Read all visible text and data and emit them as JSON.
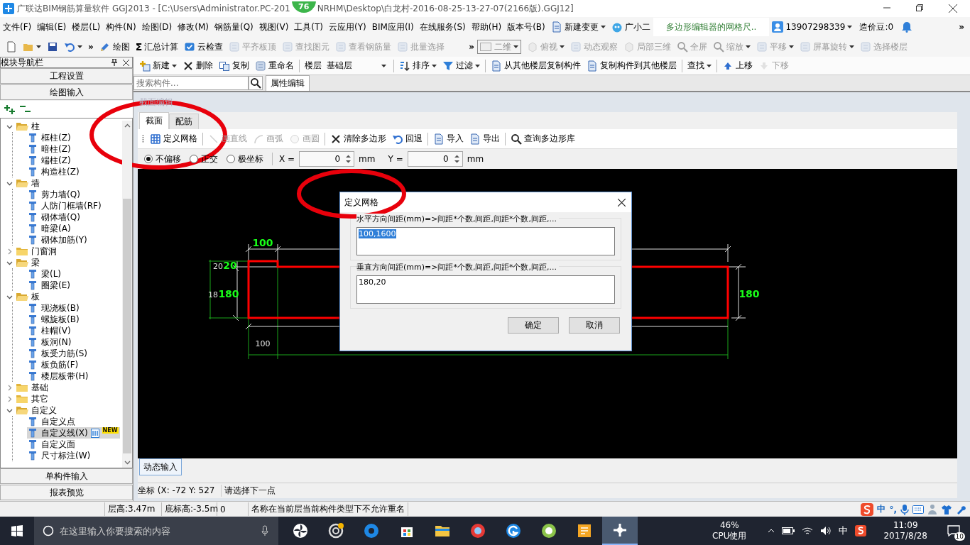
{
  "window": {
    "title_parts": [
      "广联达BIM钢筋算量软件 GGJ2013 - [C:\\Users\\Administrator.PC-201",
      "NRHM\\Desktop\\白龙村-2016-08-25-13-27-07(2166版).GGJ12]"
    ],
    "badge": "76"
  },
  "menu": [
    "文件(F)",
    "编辑(E)",
    "楼层(L)",
    "构件(N)",
    "绘图(D)",
    "修改(M)",
    "钢筋量(Q)",
    "视图(V)",
    "工具(T)",
    "云应用(Y)",
    "BIM应用(I)",
    "在线服务(S)",
    "帮助(H)",
    "版本号(B)"
  ],
  "menu_extras": {
    "new_change": "新建变更",
    "assistant": "广小二",
    "notice": "多边形编辑器的网格尺..",
    "account": "13907298339",
    "beans": "造价豆:0",
    "overflow": "»"
  },
  "main_toolbar": {
    "lead": [
      {
        "kind": "new",
        "dropdown": false
      },
      {
        "kind": "open",
        "dropdown": true
      },
      {
        "kind": "save",
        "dropdown": false
      },
      {
        "kind": "undo",
        "dropdown": true
      }
    ],
    "overflow": "»",
    "items": [
      {
        "label": "绘图",
        "kind": "pencil",
        "disabled": false,
        "dropdown": false
      },
      {
        "label": "汇总计算",
        "glyph": "Σ",
        "disabled": false,
        "dropdown": false
      },
      {
        "label": "云检查",
        "kind": "check",
        "disabled": false,
        "dropdown": false
      },
      {
        "label": "平齐板顶",
        "kind": "tool",
        "disabled": true,
        "dropdown": false
      },
      {
        "label": "查找图元",
        "kind": "tool",
        "disabled": true,
        "dropdown": false
      },
      {
        "label": "查看钢筋量",
        "kind": "tool",
        "disabled": true,
        "dropdown": false
      },
      {
        "label": "批量选择",
        "kind": "tool",
        "disabled": true,
        "dropdown": false
      }
    ],
    "view_mode": "二维",
    "overflow_right": "»",
    "view_items": [
      {
        "label": "俯视",
        "kind": "cube",
        "disabled": true,
        "dropdown": true
      },
      {
        "label": "动态观察",
        "kind": "tool",
        "disabled": true,
        "dropdown": false
      },
      {
        "label": "局部三维",
        "kind": "cube",
        "disabled": true,
        "dropdown": false
      },
      {
        "label": "全屏",
        "kind": "search",
        "disabled": true,
        "dropdown": false
      },
      {
        "label": "缩放",
        "kind": "search",
        "disabled": true,
        "dropdown": true
      },
      {
        "label": "平移",
        "kind": "tool",
        "disabled": true,
        "dropdown": true
      },
      {
        "label": "屏幕旋转",
        "kind": "tool",
        "disabled": true,
        "dropdown": true
      },
      {
        "label": "选择楼层",
        "kind": "tool",
        "disabled": true,
        "dropdown": false
      }
    ]
  },
  "navigator": {
    "title": "模块导航栏",
    "sections_top": [
      "工程设置",
      "绘图输入"
    ],
    "tree": [
      {
        "label": "柱",
        "expanded": true,
        "children": [
          {
            "label": "框柱(Z)",
            "selected": false
          },
          {
            "label": "暗柱(Z)",
            "selected": false
          },
          {
            "label": "端柱(Z)",
            "selected": false
          },
          {
            "label": "构造柱(Z)",
            "selected": false
          }
        ]
      },
      {
        "label": "墙",
        "expanded": true,
        "children": [
          {
            "label": "剪力墙(Q)",
            "selected": false
          },
          {
            "label": "人防门框墙(RF)",
            "selected": false
          },
          {
            "label": "砌体墙(Q)",
            "selected": false
          },
          {
            "label": "暗梁(A)",
            "selected": false
          },
          {
            "label": "砌体加筋(Y)",
            "selected": false
          }
        ]
      },
      {
        "label": "门窗洞",
        "expanded": false
      },
      {
        "label": "梁",
        "expanded": true,
        "children": [
          {
            "label": "梁(L)",
            "selected": false
          },
          {
            "label": "圈梁(E)",
            "selected": false
          }
        ]
      },
      {
        "label": "板",
        "expanded": true,
        "children": [
          {
            "label": "现浇板(B)",
            "selected": false
          },
          {
            "label": "螺旋板(B)",
            "selected": false
          },
          {
            "label": "柱帽(V)",
            "selected": false
          },
          {
            "label": "板洞(N)",
            "selected": false
          },
          {
            "label": "板受力筋(S)",
            "selected": false
          },
          {
            "label": "板负筋(F)",
            "selected": false
          },
          {
            "label": "楼层板带(H)",
            "selected": false
          }
        ]
      },
      {
        "label": "基础",
        "expanded": false
      },
      {
        "label": "其它",
        "expanded": false
      },
      {
        "label": "自定义",
        "expanded": true,
        "children": [
          {
            "label": "自定义点",
            "selected": false
          },
          {
            "label": "自定义线(X)",
            "selected": true,
            "badge": "NEW"
          },
          {
            "label": "自定义面",
            "selected": false
          },
          {
            "label": "尺寸标注(W)",
            "selected": false
          }
        ]
      }
    ],
    "sections_bottom": [
      "单构件输入",
      "报表预览"
    ]
  },
  "component_toolbar": {
    "items": [
      {
        "label": "新建",
        "kind": "plus",
        "disabled": false,
        "dropdown": true
      },
      {
        "label": "删除",
        "kind": "cross",
        "disabled": false,
        "dropdown": false
      },
      {
        "label": "复制",
        "kind": "copy",
        "disabled": false,
        "dropdown": false
      },
      {
        "label": "重命名",
        "kind": "tool",
        "disabled": false,
        "dropdown": false
      }
    ],
    "floor_label": "楼层",
    "floor_value": "基础层",
    "items2": [
      {
        "label": "排序",
        "kind": "sort",
        "disabled": false,
        "dropdown": true
      },
      {
        "label": "过滤",
        "kind": "funnel",
        "disabled": false,
        "dropdown": true
      },
      {
        "label": "从其他楼层复制构件",
        "kind": "doc",
        "disabled": false,
        "dropdown": false
      },
      {
        "label": "复制构件到其他楼层",
        "kind": "doc",
        "disabled": false,
        "dropdown": false
      },
      {
        "label": "查找",
        "disabled": false,
        "dropdown": true
      },
      {
        "label": "上移",
        "kind": "up",
        "disabled": false,
        "dropdown": false
      },
      {
        "label": "下移",
        "kind": "down",
        "disabled": true,
        "dropdown": false
      }
    ]
  },
  "component_search": {
    "placeholder": "搜索构件..."
  },
  "property_tab": "属性编辑",
  "section_editor": {
    "title": "截面编辑",
    "tabs": [
      {
        "label": "截面",
        "selected": true
      },
      {
        "label": "配筋",
        "selected": false
      }
    ],
    "tools": [
      {
        "label": "定义网格",
        "kind": "grid",
        "disabled": false
      },
      {
        "label": "画直线",
        "kind": "line",
        "disabled": true
      },
      {
        "label": "画弧",
        "kind": "arc",
        "disabled": true
      },
      {
        "label": "画圆",
        "kind": "circle",
        "disabled": true
      },
      {
        "label": "清除多边形",
        "kind": "cross",
        "disabled": false
      },
      {
        "label": "回退",
        "kind": "undo",
        "disabled": false
      },
      {
        "label": "导入",
        "kind": "doc",
        "disabled": false
      },
      {
        "label": "导出",
        "kind": "doc",
        "disabled": false
      },
      {
        "label": "查询多边形库",
        "kind": "search",
        "disabled": false
      }
    ],
    "snap_modes": [
      {
        "label": "不偏移",
        "selected": true
      },
      {
        "label": "正交",
        "selected": false
      },
      {
        "label": "极坐标",
        "selected": false
      }
    ],
    "x_label": "X =",
    "x_value": "0",
    "x_unit": "mm",
    "y_label": "Y =",
    "y_value": "0",
    "y_unit": "mm",
    "canvas_labels": [
      {
        "text": "100",
        "kind": "major"
      },
      {
        "text": "20",
        "kind": "minor"
      },
      {
        "text": "20",
        "kind": "major"
      },
      {
        "text": "18",
        "kind": "minor"
      },
      {
        "text": "180",
        "kind": "major"
      },
      {
        "text": "180",
        "kind": "major"
      },
      {
        "text": "100",
        "kind": "minor"
      }
    ],
    "dynamic_input": "动态输入",
    "coord": "坐标 (X: -72 Y: 527",
    "prompt": "请选择下一点"
  },
  "dialog": {
    "title": "定义网格",
    "groups": [
      {
        "label": "水平方向间距(mm)=>间距*个数,间距,间距*个数,间距,...",
        "value": "100,1600",
        "text_selected": true
      },
      {
        "label": "垂直方向间距(mm)=>间距*个数,间距,间距*个数,间距,...",
        "value": "180,20",
        "text_selected": false
      }
    ],
    "buttons": [
      "确定",
      "取消"
    ]
  },
  "status_bar": {
    "cells": [
      "层高:3.47m",
      "底标高:-3.5m",
      "0",
      "名称在当前层当前构件类型下不允许重名"
    ],
    "ime": "中",
    "ime_punct": "°,"
  },
  "taskbar": {
    "search_placeholder": "在这里输入你要搜索的内容",
    "apps": [
      {
        "kind": "pinwheel",
        "selected": false
      },
      {
        "kind": "swirl",
        "selected": false
      },
      {
        "kind": "browser",
        "selected": false
      },
      {
        "kind": "store",
        "selected": false
      },
      {
        "kind": "folder",
        "selected": false
      },
      {
        "kind": "red",
        "selected": false
      },
      {
        "kind": "blue",
        "selected": false
      },
      {
        "kind": "green",
        "selected": false
      },
      {
        "kind": "notepad",
        "selected": false
      },
      {
        "kind": "main",
        "selected": true
      }
    ],
    "cpu_percent": "46%",
    "cpu_label": "CPU使用",
    "ime": "中",
    "time": "11:09",
    "date": "2017/8/28",
    "notifications": "10"
  }
}
